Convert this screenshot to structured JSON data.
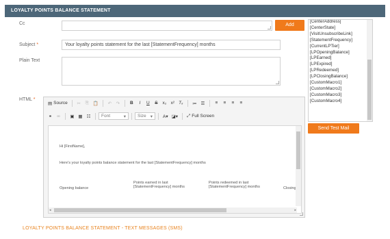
{
  "section_title": "LOYALTY POINTS BALANCE STATEMENT",
  "cc": {
    "label": "Cc",
    "value": ""
  },
  "add_button": "Add",
  "subject": {
    "label": "Subject",
    "required_mark": "*",
    "value": "Your loyalty points statement for the last [StatementFrequency] months"
  },
  "plain_text": {
    "label": "Plain Text",
    "value": ""
  },
  "html": {
    "label": "HTML",
    "required_mark": "*"
  },
  "tokens": [
    "[CenterAddress]",
    "[CenterState]",
    "[VisitUnsubscribeLink]",
    "[StatementFrequency]",
    "[CurrentLPTier]",
    "[LPOpeningBalance]",
    "[LPEarned]",
    "[LPExpired]",
    "[LPRedeemed]",
    "[LPClosingBalance]",
    "[CustomMacro1]",
    "[CustomMacro2]",
    "[CustomMacro3]",
    "[CustomMacro4]"
  ],
  "send_test_mail": "Send Test Mail",
  "toolbar": {
    "source": "Source",
    "font": "Font",
    "size": "Size",
    "full_screen": "Full Screen"
  },
  "editor_content": {
    "greeting": "Hi [FirstName],",
    "intro": "Here's your loyalty points balance statement for the last [StatementFrequency] months",
    "col_opening": "Opening balance",
    "col_earned_1": "Points earned in last",
    "col_earned_2": "[StatementFrequency] months",
    "col_redeemed_1": "Points redeemed in last",
    "col_redeemed_2": "[StatementFrequency] months",
    "col_closing": "Closing ba"
  },
  "sms_section_title": "LOYALTY POINTS BALANCE STATEMENT - TEXT MESSAGES (SMS)",
  "colors": {
    "header": "#4d6779",
    "accent": "#f07a1b"
  }
}
